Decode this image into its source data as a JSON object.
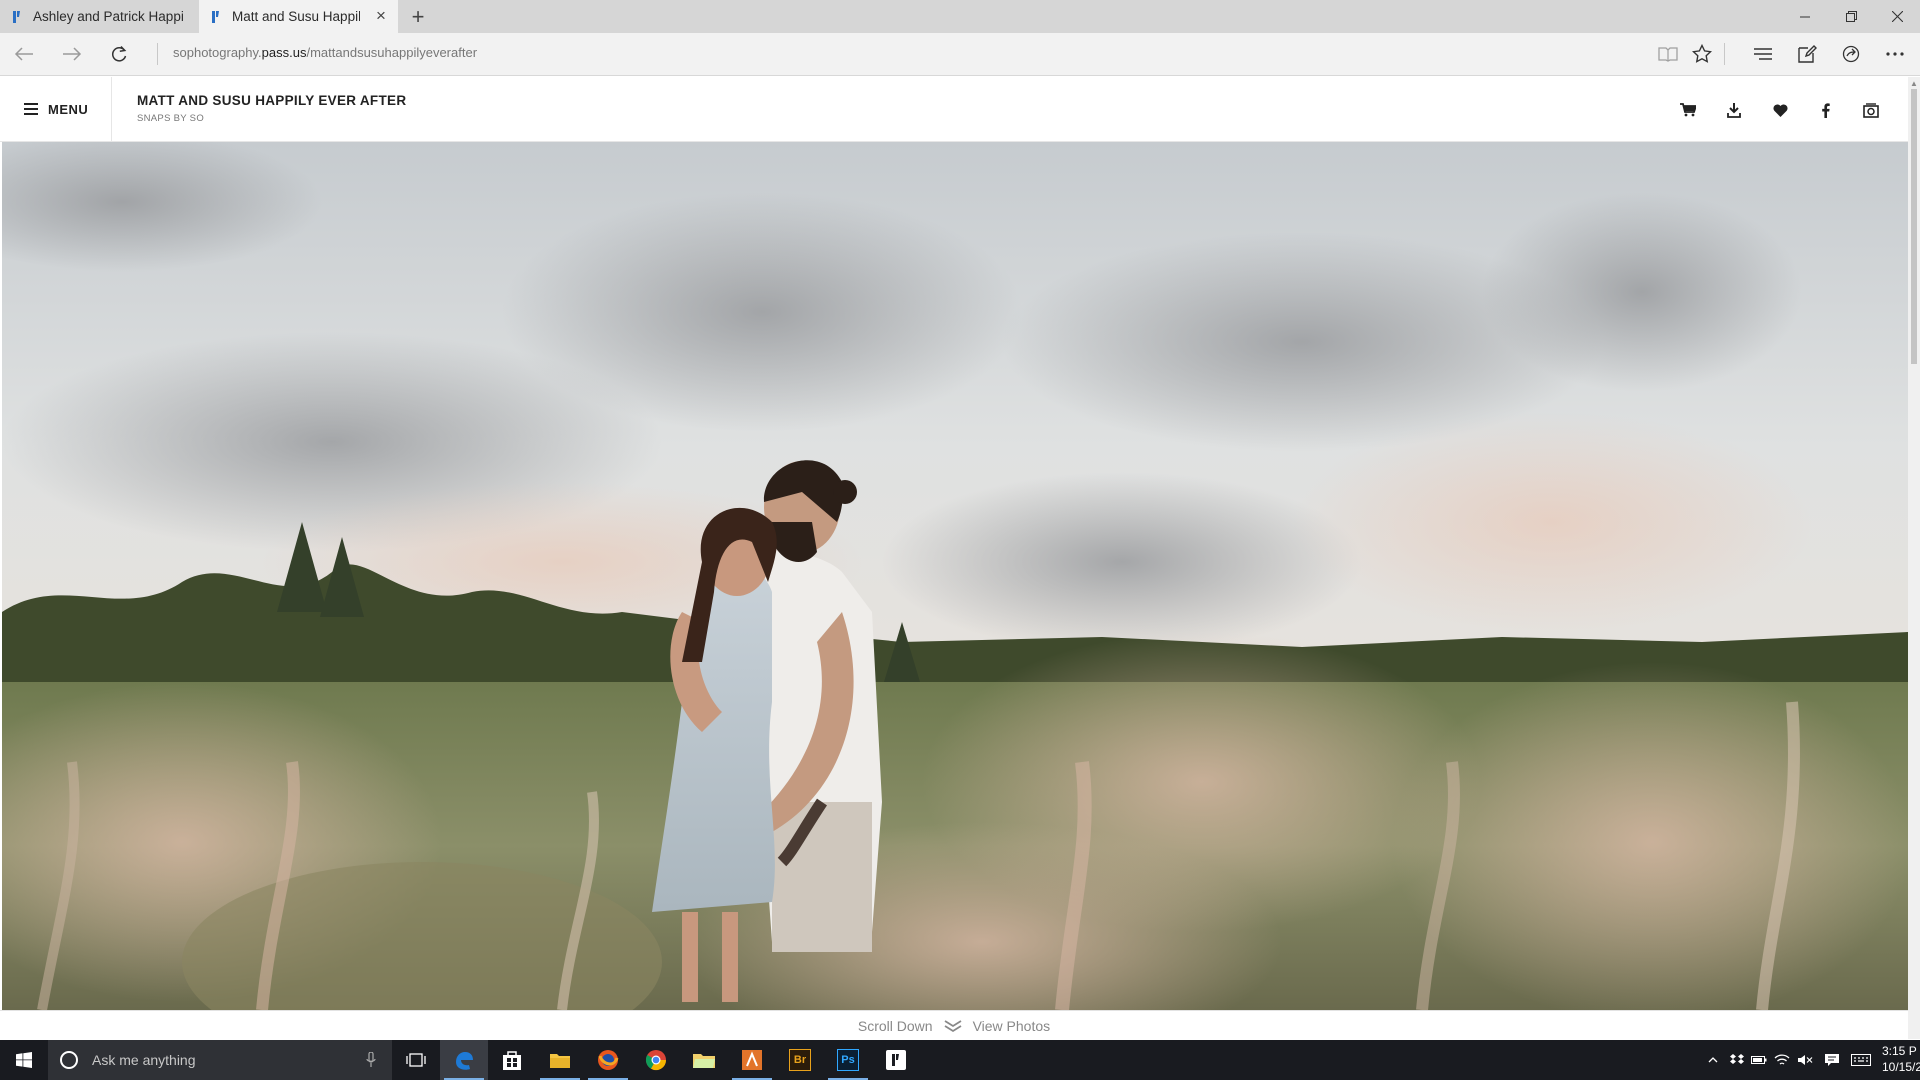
{
  "browser": {
    "tabs": [
      {
        "title": "Ashley and Patrick Happily E",
        "active": false
      },
      {
        "title": "Matt and Susu Happily E",
        "active": true
      }
    ],
    "url_prefix": "sophotography.",
    "url_host": "pass.us",
    "url_path": "/mattandsusuhappilyeverafter"
  },
  "site": {
    "menu_label": "MENU",
    "title": "MATT AND SUSU HAPPILY EVER AFTER",
    "subtitle": "SNAPS BY SO",
    "header_icons": [
      "cart-icon",
      "download-icon",
      "heart-icon",
      "facebook-icon",
      "slideshow-icon"
    ]
  },
  "hero": {
    "scroll_down_label": "Scroll Down",
    "view_photos_label": "View Photos"
  },
  "taskbar": {
    "search_placeholder": "Ask me anything",
    "apps": [
      "task-view-icon",
      "edge-icon",
      "store-icon",
      "file-explorer-icon",
      "firefox-icon",
      "chrome-icon",
      "folder-icon",
      "illustrator-like-icon",
      "bridge-icon",
      "photoshop-icon",
      "pass-icon"
    ],
    "bridge_label": "Br",
    "photoshop_label": "Ps",
    "clock_time": "3:15 P",
    "clock_date": "10/15/2"
  },
  "colors": {
    "tabstrip": "#d6d6d6",
    "taskbar": "#191b20",
    "edge_blue": "#1e7ad6"
  }
}
